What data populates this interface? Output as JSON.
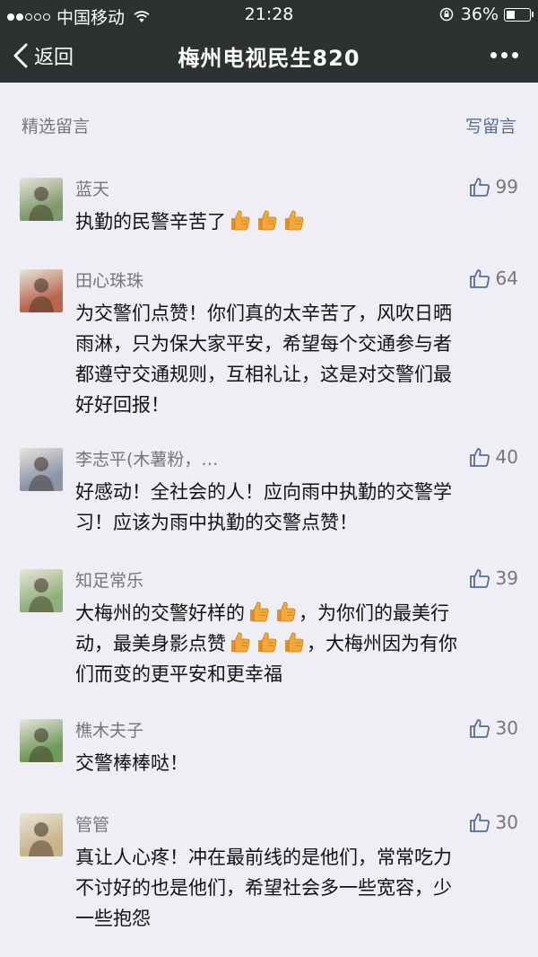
{
  "status": {
    "carrier": "中国移动",
    "time": "21:28",
    "battery": "36%",
    "battery_level": 0.36
  },
  "nav": {
    "back_label": "返回",
    "title": "梅州电视民生820"
  },
  "section": {
    "label": "精选留言",
    "write_label": "写留言"
  },
  "comments": [
    {
      "name": "蓝天",
      "likes": "99",
      "text": "执勤的民警辛苦了",
      "thumbs": 3,
      "avatar_color": "#7f9a6b"
    },
    {
      "name": "田心珠珠",
      "likes": "64",
      "text": "为交警们点赞！你们真的太辛苦了，风吹日晒\n雨淋，只为保大家平安，希望每个交通参与者\n都遵守交通规则，互相礼让，这是对交警们最\n好好回报！",
      "avatar_color": "#b8664d"
    },
    {
      "name": "李志平(木薯粉，…",
      "likes": "40",
      "text": "好感动！全社会的人！应向雨中执勤的交警学\n习！应该为雨中执勤的交警点赞！",
      "avatar_color": "#8a95a8"
    },
    {
      "name": "知足常乐",
      "likes": "39",
      "text_parts": [
        "大梅州的交警好样的",
        "，为你们的最美行\n动，最美身影点赞",
        "，大梅州因为有你\n们而变的更平安和更幸福"
      ],
      "avatar_color": "#8fb07a"
    },
    {
      "name": "樵木夫子",
      "likes": "30",
      "text": "交警棒棒哒！",
      "avatar_color": "#6f9a5a"
    },
    {
      "name": "管管",
      "likes": "30",
      "text": "真让人心疼！冲在最前线的是他们，常常吃力\n不讨好的也是他们，希望社会多一些宽容，少\n一些抱怨",
      "avatar_color": "#c9b48a"
    }
  ],
  "icons": {
    "like": "thumbs-up-outline-icon",
    "emoji": "thumbs-up-emoji-icon"
  },
  "colors": {
    "bar": "#2e3132",
    "background": "#eeeef4",
    "link": "#576b95",
    "emoji": "#f3a93a"
  }
}
